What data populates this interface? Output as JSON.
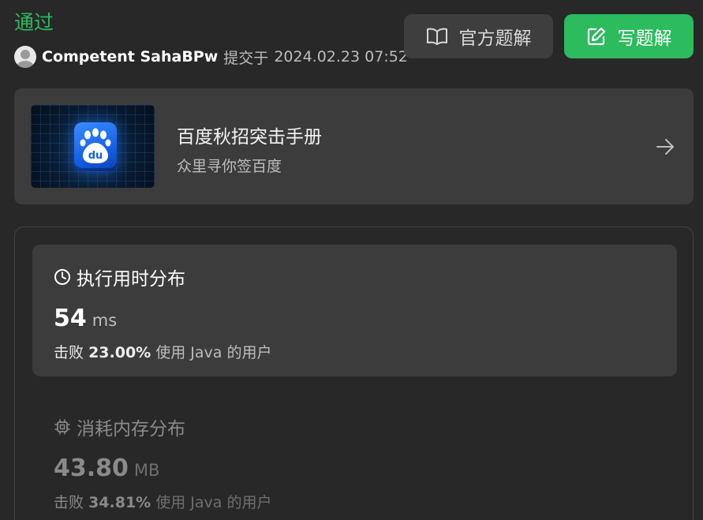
{
  "header": {
    "status": "通过",
    "status_color": "#2cbb5d",
    "username": "Competent SahaBPw",
    "submitted_prefix": "提交于",
    "submitted_time": "2024.02.23 07:52"
  },
  "buttons": {
    "official_solution": {
      "label": "官方题解",
      "icon": "book-icon"
    },
    "write_solution": {
      "label": "写题解",
      "icon": "edit-icon",
      "color": "#2cbb5d"
    }
  },
  "promo": {
    "title": "百度秋招突击手册",
    "subtitle": "众里寻你签百度",
    "logo_icon": "baidu-paw-icon",
    "logo_text": "du",
    "arrow_icon": "arrow-right-icon"
  },
  "runtime": {
    "title": "执行用时分布",
    "icon": "clock-icon",
    "value": "54",
    "unit": "ms",
    "beats_prefix": "击败",
    "beats_percent": "23.00%",
    "beats_suffix": "使用 Java 的用户"
  },
  "memory": {
    "title": "消耗内存分布",
    "icon": "cpu-chip-icon",
    "value": "43.80",
    "unit": "MB",
    "beats_prefix": "击败",
    "beats_percent": "34.81%",
    "beats_suffix": "使用 Java 的用户"
  }
}
